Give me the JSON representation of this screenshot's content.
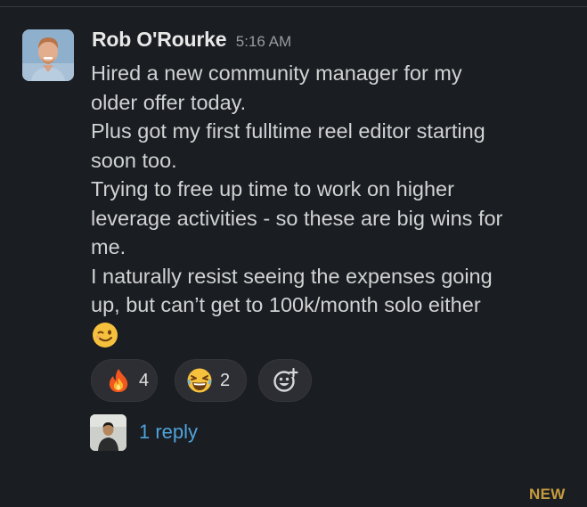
{
  "message": {
    "author": "Rob O'Rourke",
    "time": "5:16 AM",
    "lines": [
      "Hired a new community manager for my",
      "older offer today.",
      "Plus got my first fulltime reel editor starting",
      "soon too.",
      "Trying to free up time to work on higher",
      "leverage activities - so these are big wins for",
      "me.",
      "I naturally resist seeing the expenses going",
      "up, but can’t get to 100k/month solo either"
    ],
    "trailing_emoji": "winking-face"
  },
  "reactions": [
    {
      "emoji": "fire",
      "count": "4"
    },
    {
      "emoji": "laughing-face",
      "count": "2"
    }
  ],
  "add_reaction_icon": "add-emoji-icon",
  "thread": {
    "reply_label": "1 reply"
  },
  "new_label": "NEW",
  "colors": {
    "background": "#1a1d21",
    "link": "#4fa3dc",
    "new_marker": "#c69b3f"
  }
}
